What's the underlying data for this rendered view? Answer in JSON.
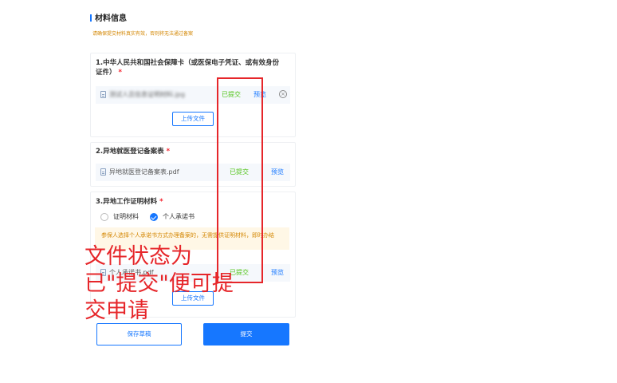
{
  "section": {
    "title": "材料信息",
    "hint": "请确保提交材料真实有效，否则将无法通过备案"
  },
  "materials": [
    {
      "title": "1.中华人民共和国社会保障卡（或医保电子凭证、或有效身份证件）",
      "required": "*",
      "file_name": "测试人员信息证明材料.jpg",
      "status": "已提交",
      "preview": "预览",
      "remove_icon": "close-circle-icon",
      "upload_label": "上传文件"
    },
    {
      "title": "2.异地就医登记备案表",
      "required": "*",
      "file_name": "异地就医登记备案表.pdf",
      "status": "已提交",
      "preview": "预览"
    },
    {
      "title": "3.异地工作证明材料",
      "required": "*",
      "options": [
        "证明材料",
        "个人承诺书"
      ],
      "selected_option": "个人承诺书",
      "notice": "参保人选择个人承诺书方式办理备案的，无需提供证明材料，即时办结",
      "file_name": "个人承诺书.pdf",
      "status": "已提交",
      "preview": "预览",
      "upload_label": "上传文件"
    }
  ],
  "actions": {
    "draft_label": "保存草稿",
    "submit_label": "提交"
  },
  "annotation": {
    "text": "文件状态为已\"提交\"便可提交申请",
    "color": "#e6262a"
  },
  "colors": {
    "accent": "#1677ff",
    "success": "#52c41a",
    "warning": "#d48806"
  }
}
